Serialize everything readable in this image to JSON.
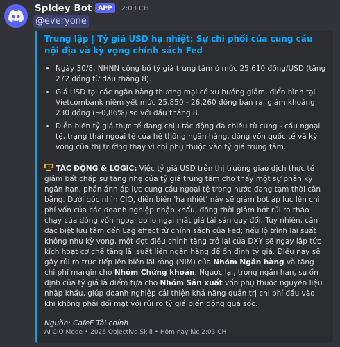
{
  "message": {
    "username": "Spidey Bot",
    "badge": "APP",
    "timestamp": "2:03 CH",
    "mention": "@everyone"
  },
  "embed": {
    "title": "Trung lập | Tỷ giá USD hạ nhiệt: Sự chi phối của cung cầu nội địa và kỳ vọng chính sách Fed",
    "accent_color": "#1e9bdc",
    "bullets": [
      "Ngày 30/8, NHNN công bố tỷ giá trung tâm ở mức 25.610 đồng/USD (tăng 272 đồng từ đầu tháng 8).",
      "Giá USD tại các ngân hàng thương mại có xu hướng giảm, điển hình tại Vietcombank niêm yết mức 25.850 - 26.260 đồng bán ra, giảm khoảng 230 đồng (~0,86%) so với đầu tháng 8.",
      "Diễn biến tỷ giá thực tế đang chịu tác động đa chiều từ cung - cầu ngoại tệ, trạng thái ngoại tệ của hệ thống ngân hàng, dòng vốn quốc tế và kỳ vọng của thị trường thay vì chỉ phụ thuộc vào tỷ giá trung tâm."
    ],
    "impact_icon": "scale-icon",
    "impact_label": "TÁC ĐỘNG & LOGIC:",
    "impact_text_1": " Việc tỷ giá USD trên thị trường giao dịch thực tế giảm bất chấp sự tăng nhẹ của tỷ giá trung tâm cho thấy một sự phân kỳ ngắn hạn, phản ánh áp lực cung cầu ngoại tệ trong nước đang tạm thời cân bằng. Dưới góc nhìn CIO, diễn biến 'hạ nhiệt' này sẽ giảm bớt áp lực lên chi phí vốn của các doanh nghiệp nhập khẩu, đồng thời giảm bớt rủi ro tháo chạy của dòng vốn ngoại do lo ngại mất giá tài sản quy đổi. Tuy nhiên, cần đặc biệt lưu tâm đến Lag effect từ chính sách của Fed; nếu lộ trình lãi suất không như kỳ vọng, một đợt điều chỉnh tăng trở lại của DXY sẽ ngay lập tức kích hoạt cơ chế tăng lãi suất liên ngân hàng để ổn định tỷ giá. Điều này sẽ gây rủi ro trực tiếp lên biên lãi ròng (NIM) của ",
    "impact_bold_1": "Nhóm Ngân hàng",
    "impact_text_2": " và tăng chi phí margin cho ",
    "impact_bold_2": "Nhóm Chứng khoán",
    "impact_text_3": ". Ngược lại, trong ngắn hạn, sự ổn định của tỷ giá là điểm tựa cho ",
    "impact_bold_3": "Nhóm Sản xuất",
    "impact_text_4": " vốn phụ thuộc nguyên liệu nhập khẩu, giúp doanh nghiệp cải thiện khả năng quản trị chi phí đầu vào khi không phải đối mặt với rủi ro tỷ giá biến động quá sốc.",
    "source": "Nguồn: CafeF Tài chính",
    "footer": "AI CIO Mode • 2026 Objective Skill • Hôm nay lúc 2:03 CH"
  }
}
